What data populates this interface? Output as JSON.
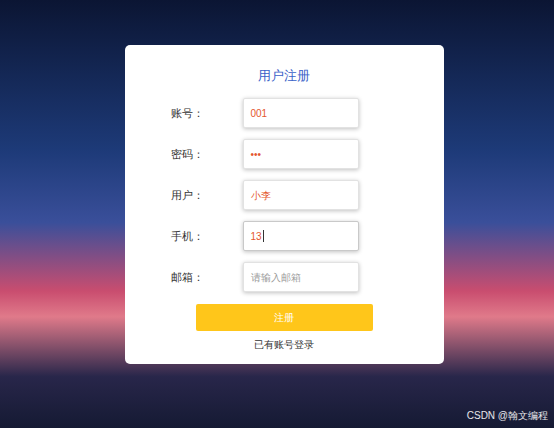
{
  "form": {
    "title": "用户注册",
    "fields": [
      {
        "label": "账号：",
        "value": "001",
        "placeholder": "",
        "focused": false
      },
      {
        "label": "密码：",
        "value": "•••",
        "placeholder": "",
        "focused": false
      },
      {
        "label": "用户：",
        "value": "小李",
        "placeholder": "",
        "focused": false
      },
      {
        "label": "手机：",
        "value": "13",
        "placeholder": "",
        "focused": true
      },
      {
        "label": "邮箱：",
        "value": "",
        "placeholder": "请输入邮箱",
        "focused": false
      }
    ],
    "submit": "注册",
    "login_link": "已有账号登录"
  },
  "watermark": "CSDN @翰文编程"
}
